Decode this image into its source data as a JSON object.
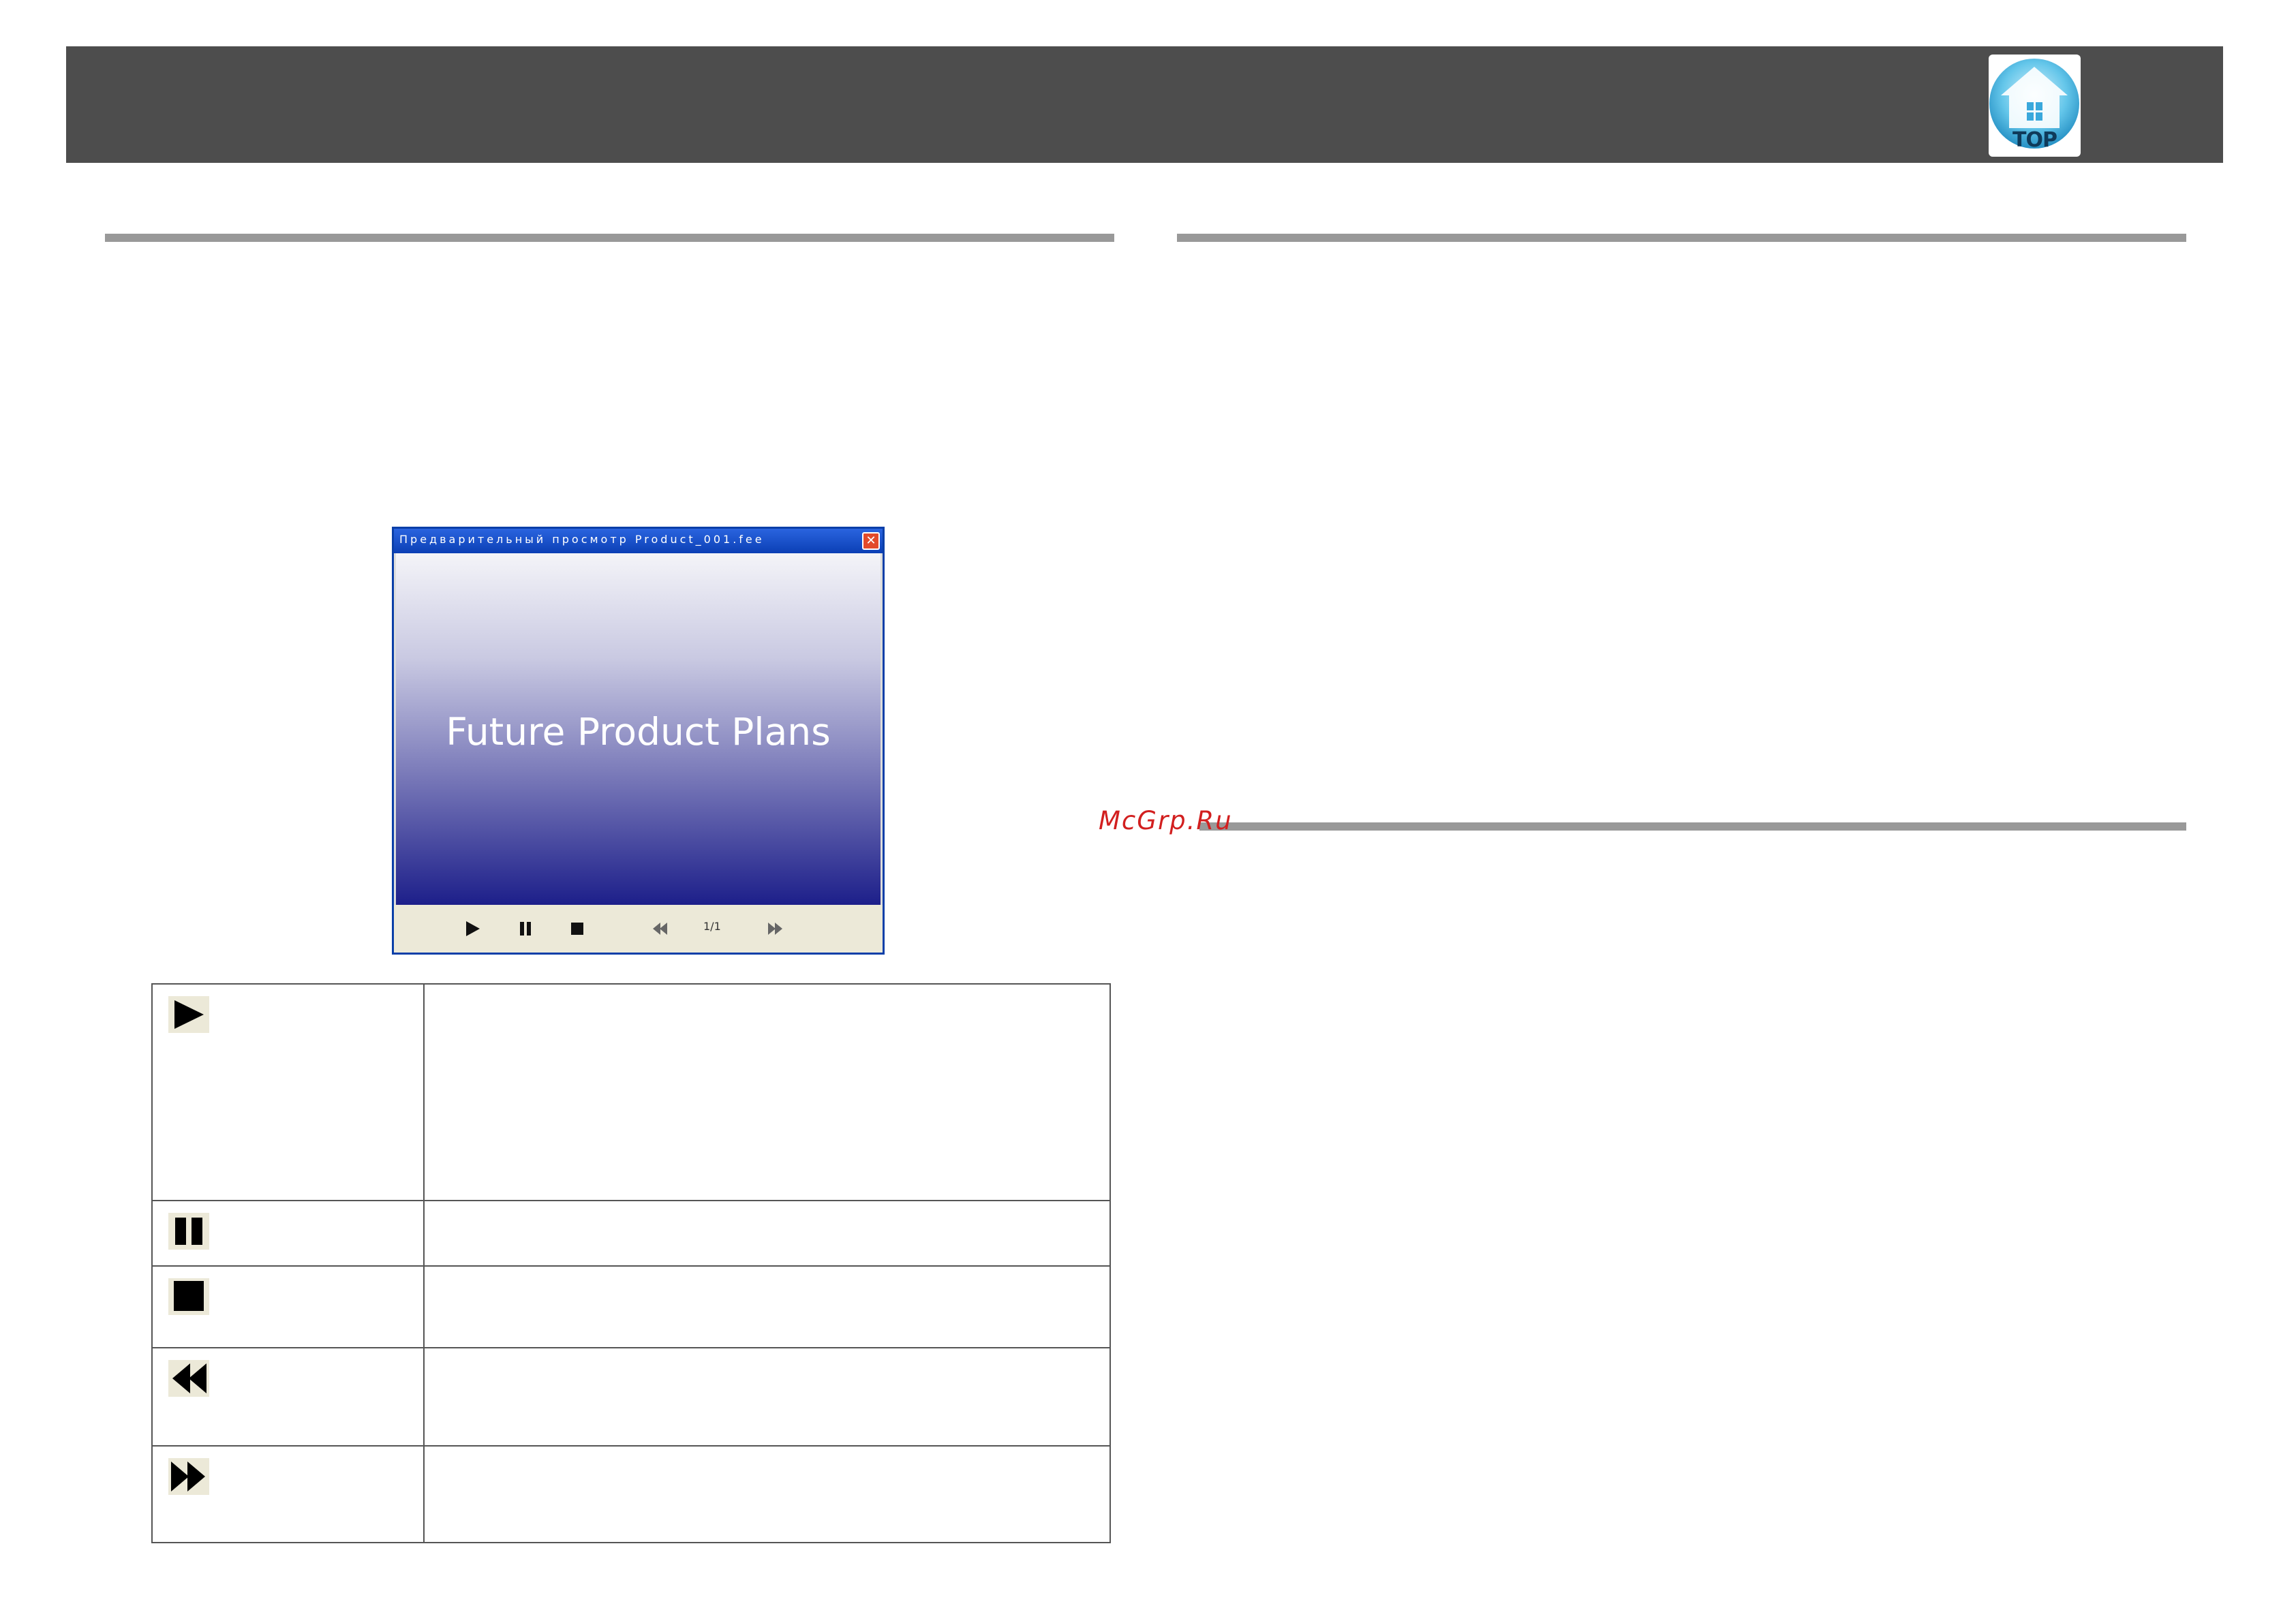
{
  "header": {
    "top_button_label": "TOP"
  },
  "watermark": "McGrp.Ru",
  "preview": {
    "window_title": "Предварительный просмотр Product_001.fee",
    "close_glyph": "✕",
    "slide_title": "Future Product Plans",
    "page_indicator": "1/1",
    "toolbar_icons": [
      "play-icon",
      "pause-icon",
      "stop-icon",
      "rewind-icon",
      "fast-forward-icon"
    ]
  },
  "controls_table": {
    "rows": [
      {
        "icon": "play-icon"
      },
      {
        "icon": "pause-icon"
      },
      {
        "icon": "stop-icon"
      },
      {
        "icon": "rewind-icon"
      },
      {
        "icon": "fast-forward-icon"
      }
    ]
  },
  "colors": {
    "header": "#4d4d4d",
    "rule": "#999999",
    "watermark": "#d21f1f",
    "window_border": "#0a3fa8",
    "slide_gradient_end": "#1d1f8a"
  }
}
